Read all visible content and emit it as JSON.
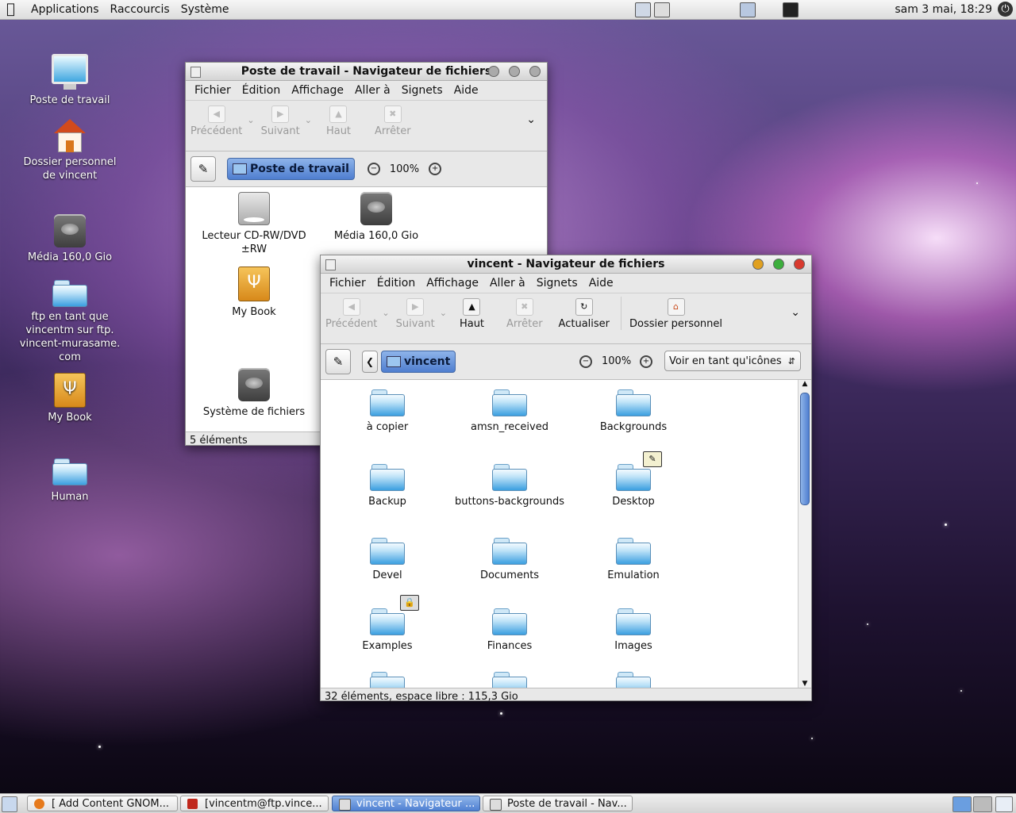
{
  "top_panel": {
    "menus": [
      "Applications",
      "Raccourcis",
      "Système"
    ],
    "clock": "sam  3 mai, 18:29"
  },
  "desktop_icons": [
    {
      "label": "Poste de travail",
      "icon": "computer-icon"
    },
    {
      "label": "Dossier personnel de vincent",
      "icon": "home-folder-icon"
    },
    {
      "label": "Média 160,0 Gio",
      "icon": "hard-drive-icon"
    },
    {
      "label": "ftp en tant que vincentm sur ftp. vincent-murasame. com",
      "icon": "network-folder-icon"
    },
    {
      "label": "My Book",
      "icon": "usb-drive-icon"
    },
    {
      "label": "Human",
      "icon": "folder-icon"
    }
  ],
  "window_computer": {
    "title": "Poste de travail - Navigateur de fichiers",
    "menus": [
      "Fichier",
      "Édition",
      "Affichage",
      "Aller à",
      "Signets",
      "Aide"
    ],
    "toolbar": {
      "back": "Précédent",
      "forward": "Suivant",
      "up": "Haut",
      "stop": "Arrêter"
    },
    "location": "Poste de travail",
    "zoom": "100%",
    "items": [
      {
        "label": "Lecteur CD-RW/DVD ±RW",
        "icon": "optical-drive-icon"
      },
      {
        "label": "Média 160,0 Gio",
        "icon": "hard-drive-icon"
      },
      {
        "label": "My Book",
        "icon": "usb-drive-icon"
      },
      {
        "label": "Système de fichiers",
        "icon": "hard-drive-icon"
      }
    ],
    "status": "5 éléments"
  },
  "window_home": {
    "title": "vincent - Navigateur de fichiers",
    "menus": [
      "Fichier",
      "Édition",
      "Affichage",
      "Aller à",
      "Signets",
      "Aide"
    ],
    "toolbar": {
      "back": "Précédent",
      "forward": "Suivant",
      "up": "Haut",
      "stop": "Arrêter",
      "reload": "Actualiser",
      "home": "Dossier personnel"
    },
    "location": "vincent",
    "zoom": "100%",
    "view_mode": "Voir en tant qu'icônes",
    "items": [
      "à copier",
      "amsn_received",
      "Backgrounds",
      "Backup",
      "buttons-backgrounds",
      "Desktop",
      "Devel",
      "Documents",
      "Emulation",
      "Examples",
      "Finances",
      "Images"
    ],
    "status": "32 éléments, espace libre : 115,3 Gio"
  },
  "taskbar": [
    {
      "label": "[ Add Content GNOM...",
      "icon": "firefox-icon"
    },
    {
      "label": "[vincentm@ftp.vince...",
      "icon": "filezilla-icon"
    },
    {
      "label": "vincent - Navigateur ...",
      "icon": "file-manager-icon"
    },
    {
      "label": "Poste de travail - Nav...",
      "icon": "file-manager-icon"
    }
  ],
  "colors": {
    "accent": "#4f7ed0",
    "close": "#d83a2e",
    "minimize": "#e0a020",
    "maximize": "#3cae3c"
  }
}
